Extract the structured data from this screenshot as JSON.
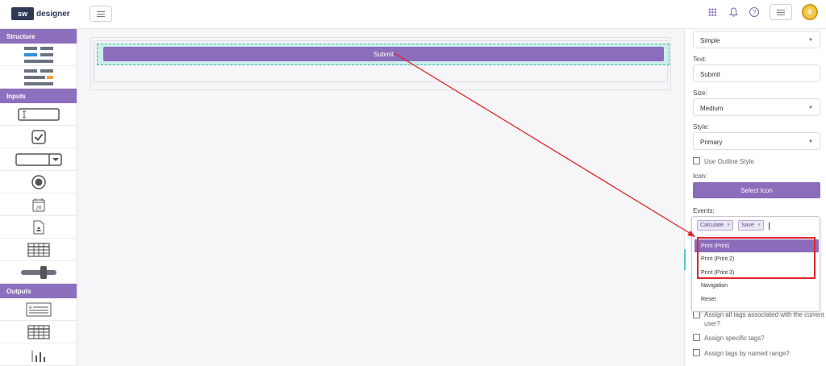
{
  "brand": {
    "logo_mark": "sw",
    "logo_text": "designer"
  },
  "header": {
    "menu_icon": "hamburger-icon",
    "icons": [
      "apps-grid-icon",
      "bell-icon",
      "help-icon",
      "menu-icon",
      "avatar"
    ],
    "help_glyph": "?"
  },
  "sidebar": {
    "structure_label": "Structure",
    "inputs_label": "Inputs",
    "outputs_label": "Outputs"
  },
  "canvas": {
    "button_label": "Submit"
  },
  "props": {
    "layout_value": "Simple",
    "text_label": "Text:",
    "text_value": "Submit",
    "size_label": "Size:",
    "size_value": "Medium",
    "style_label": "Style:",
    "style_value": "Primary",
    "outline_label": "Use Outline Style",
    "icon_label": "Icon:",
    "select_icon_label": "Select Icon",
    "events_label": "Events:",
    "tags": [
      "Calculate",
      "Save"
    ],
    "tag_remove": "×",
    "options": [
      "Print (Print)",
      "Print (Print 2)",
      "Print (Print 3)",
      "Navigation",
      "Reset"
    ],
    "assign_all_label_1": "Assign all tags associated with the current",
    "assign_all_label_2": "user?",
    "assign_specific_label": "Assign specific tags?",
    "assign_named_label": "Assign tags by named range?"
  },
  "colors": {
    "accent": "#8b6dbb",
    "annotation": "#e0262d",
    "selection": "#3fb7a8"
  }
}
